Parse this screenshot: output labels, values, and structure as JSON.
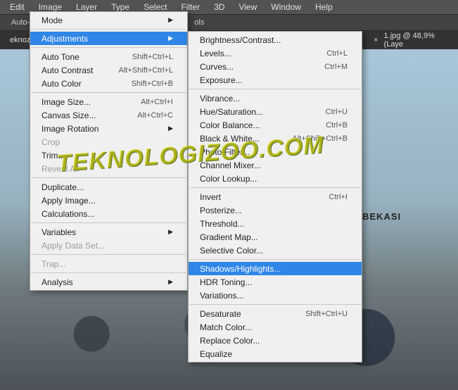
{
  "menubar": {
    "items": [
      "Edit",
      "Image",
      "Layer",
      "Type",
      "Select",
      "Filter",
      "3D",
      "View",
      "Window",
      "Help"
    ]
  },
  "toolbar": {
    "auto": "Auto-",
    "ols": "ols"
  },
  "tabbar": {
    "tab1": "eknozo",
    "tab2": "1.jpg @ 48,9% (Laye",
    "close": "×"
  },
  "image_sign": "N BEKASI",
  "watermark": "TEKNOLOGIZOO.COM",
  "menu": {
    "mode": "Mode",
    "adjustments": "Adjustments",
    "autotone": "Auto Tone",
    "autotone_s": "Shift+Ctrl+L",
    "autocontrast": "Auto Contrast",
    "autocontrast_s": "Alt+Shift+Ctrl+L",
    "autocolor": "Auto Color",
    "autocolor_s": "Shift+Ctrl+B",
    "imagesize": "Image Size...",
    "imagesize_s": "Alt+Ctrl+I",
    "canvassize": "Canvas Size...",
    "canvassize_s": "Alt+Ctrl+C",
    "imagerot": "Image Rotation",
    "crop": "Crop",
    "trim": "Trim...",
    "revealall": "Reveal All",
    "duplicate": "Duplicate...",
    "applyimage": "Apply Image...",
    "calculations": "Calculations...",
    "variables": "Variables",
    "applydataset": "Apply Data Set...",
    "trap": "Trap...",
    "analysis": "Analysis"
  },
  "sub": {
    "bc": "Brightness/Contrast...",
    "levels": "Levels...",
    "levels_s": "Ctrl+L",
    "curves": "Curves...",
    "curves_s": "Ctrl+M",
    "exposure": "Exposure...",
    "vibrance": "Vibrance...",
    "huesat": "Hue/Saturation...",
    "huesat_s": "Ctrl+U",
    "colorbal": "Color Balance...",
    "colorbal_s": "Ctrl+B",
    "bw": "Black & White...",
    "bw_s": "Alt+Shift+Ctrl+B",
    "photofilter": "Photo Filter...",
    "channelmix": "Channel Mixer...",
    "colorlookup": "Color Lookup...",
    "invert": "Invert",
    "invert_s": "Ctrl+I",
    "posterize": "Posterize...",
    "threshold": "Threshold...",
    "gradmap": "Gradient Map...",
    "selcolor": "Selective Color...",
    "shadhigh": "Shadows/Highlights...",
    "hdr": "HDR Toning...",
    "variations": "Variations...",
    "desat": "Desaturate",
    "desat_s": "Shift+Ctrl+U",
    "matchcolor": "Match Color...",
    "replacecolor": "Replace Color...",
    "equalize": "Equalize"
  }
}
